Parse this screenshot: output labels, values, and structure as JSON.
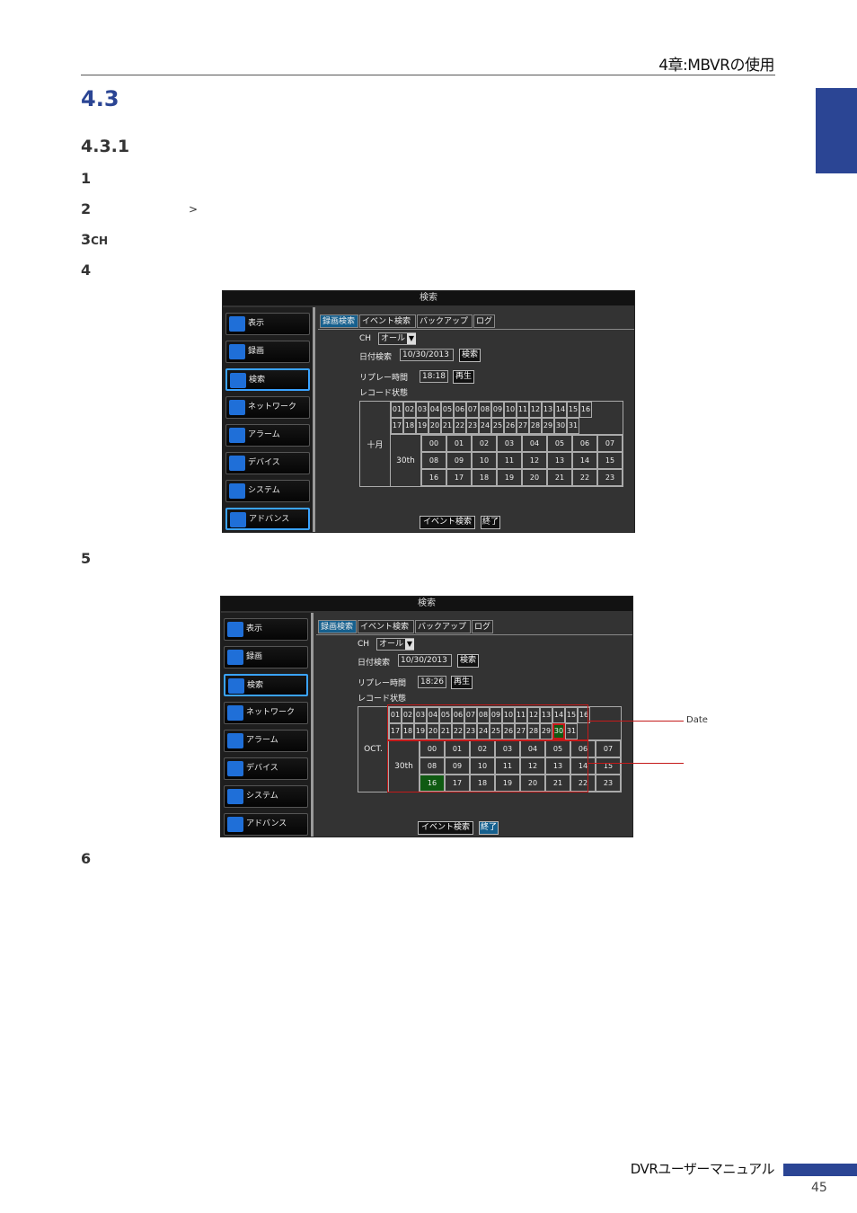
{
  "header": {
    "title": "4章:MBVRの使用"
  },
  "section": {
    "number": "4.3"
  },
  "subsection": {
    "number": "4.3.1"
  },
  "steps": [
    {
      "num": "1"
    },
    {
      "num": "2",
      "gt": ">"
    },
    {
      "num": "3",
      "suffix": "CH"
    },
    {
      "num": "4"
    },
    {
      "num": "5"
    },
    {
      "num": "6"
    }
  ],
  "screen1": {
    "title": "検索",
    "nav": [
      "表示",
      "録画",
      "検索",
      "ネットワーク",
      "アラーム",
      "デバイス",
      "システム",
      "アドバンス"
    ],
    "tabs": [
      "録画検索",
      "イベント検索",
      "バックアップ",
      "ログ"
    ],
    "ch_label": "CH",
    "ch_value": "オール",
    "date_label": "日付検索",
    "date_value": "10/30/2013",
    "search_btn": "検索",
    "replay_label": "リプレー時間",
    "replay_value": "18:18",
    "play_btn": "再生",
    "status_label": "レコード状態",
    "month_label": "十月",
    "day_label": "30th",
    "event_btn": "イベント検索",
    "exit_btn": "終了"
  },
  "screen2": {
    "title": "検索",
    "nav": [
      "表示",
      "録画",
      "検索",
      "ネットワーク",
      "アラーム",
      "デバイス",
      "システム",
      "アドバンス"
    ],
    "tabs": [
      "録画検索",
      "イベント検索",
      "バックアップ",
      "ログ"
    ],
    "ch_label": "CH",
    "ch_value": "オール",
    "date_label": "日付検索",
    "date_value": "10/30/2013",
    "search_btn": "検索",
    "replay_label": "リプレー時間",
    "replay_value": "18:26",
    "play_btn": "再生",
    "status_label": "レコード状態",
    "month_label": "OCT.",
    "day_label": "30th",
    "event_btn": "イベント検索",
    "exit_btn": "終了"
  },
  "calendar_days_row1": [
    "01",
    "02",
    "03",
    "04",
    "05",
    "06",
    "07",
    "08",
    "09",
    "10",
    "11",
    "12",
    "13",
    "14",
    "15",
    "16"
  ],
  "calendar_days_row2": [
    "17",
    "18",
    "19",
    "20",
    "21",
    "22",
    "23",
    "24",
    "25",
    "26",
    "27",
    "28",
    "29",
    "30",
    "31"
  ],
  "calendar_hours": [
    [
      "00",
      "01",
      "02",
      "03",
      "04",
      "05",
      "06",
      "07"
    ],
    [
      "08",
      "09",
      "10",
      "11",
      "12",
      "13",
      "14",
      "15"
    ],
    [
      "16",
      "17",
      "18",
      "19",
      "20",
      "21",
      "22",
      "23"
    ]
  ],
  "callout": {
    "date": "Date"
  },
  "footer": {
    "title": "DVRユーザーマニュアル",
    "page": "45"
  },
  "colors": {
    "accent": "#2b4594",
    "highlight": "#c41a1a",
    "record": "#0f5a12",
    "selected": "#16608e"
  }
}
